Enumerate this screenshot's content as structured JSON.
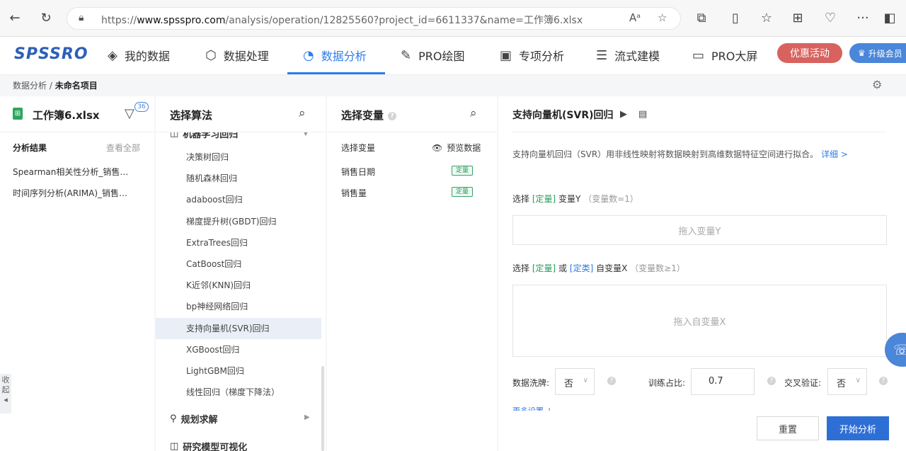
{
  "browser": {
    "url_prefix": "https://",
    "url_host": "www.spsspro.com",
    "url_path": "/analysis/operation/12825560?project_id=6611337&name=工作簿6.xlsx",
    "read_aloud": "Aᵃ",
    "more_dots": "···"
  },
  "app": {
    "logo_a": "SPSS",
    "logo_b": "RO",
    "nav": [
      "我的数据",
      "数据处理",
      "数据分析",
      "PRO绘图",
      "专项分析",
      "流式建模",
      "PRO大屏"
    ],
    "promo_label": "优惠活动",
    "upgrade_label": "升级会员"
  },
  "breadcrumb": {
    "root": "数据分析",
    "sep": " / ",
    "current": "未命名项目"
  },
  "left": {
    "file_name": "工作簿6.xlsx",
    "filter_count": "36",
    "results_header": "分析结果",
    "view_all": "查看全部",
    "results": [
      "Spearman相关性分析_销售…",
      "时间序列分析(ARIMA)_销售…"
    ],
    "collapse_label_1": "收",
    "collapse_label_2": "起",
    "collapse_arrow": "◂"
  },
  "algorithms": {
    "header": "选择算法",
    "group_top": "机器学习回归",
    "items": [
      "决策树回归",
      "随机森林回归",
      "adaboost回归",
      "梯度提升树(GBDT)回归",
      "ExtraTrees回归",
      "CatBoost回归",
      "K近邻(KNN)回归",
      "bp神经网络回归",
      "支持向量机(SVR)回归",
      "XGBoost回归",
      "LightGBM回归",
      "线性回归（梯度下降法）"
    ],
    "group_planning": "规划求解",
    "group_research": "研究模型可视化"
  },
  "variables": {
    "header": "选择变量",
    "select_link": "选择变量",
    "preview_link": "预览数据",
    "rows": [
      {
        "name": "销售日期",
        "type": "定量"
      },
      {
        "name": "销售量",
        "type": "定量"
      }
    ]
  },
  "config": {
    "title": "支持向量机(SVR)回归",
    "description": "支持向量机回归（SVR）用非线性映射将数据映射到高维数据特征空间进行拟合。",
    "detail_link": "详细 >",
    "y_select": "选择",
    "y_tag": "[定量]",
    "y_label": "变量Y",
    "y_count": "（变量数=1）",
    "y_drop": "拖入变量Y",
    "x_select": "选择",
    "x_tag_1": "[定量]",
    "x_or": "或",
    "x_tag_2": "[定类]",
    "x_label": "自变量X",
    "x_count": "（变量数≥1）",
    "x_drop": "拖入自变量X",
    "shuffle_label": "数据洗牌:",
    "shuffle_value": "否",
    "train_label": "训练占比:",
    "train_value": "0.7",
    "cv_label": "交叉验证:",
    "cv_value": "否",
    "more_settings": "更多设置 ↓",
    "reset_label": "重置",
    "start_label": "开始分析"
  },
  "colors": {
    "accent": "#2e7be8",
    "promo": "#d8625e",
    "quant_tag": "#2a9a5c",
    "start_button": "#2e6fd6"
  }
}
